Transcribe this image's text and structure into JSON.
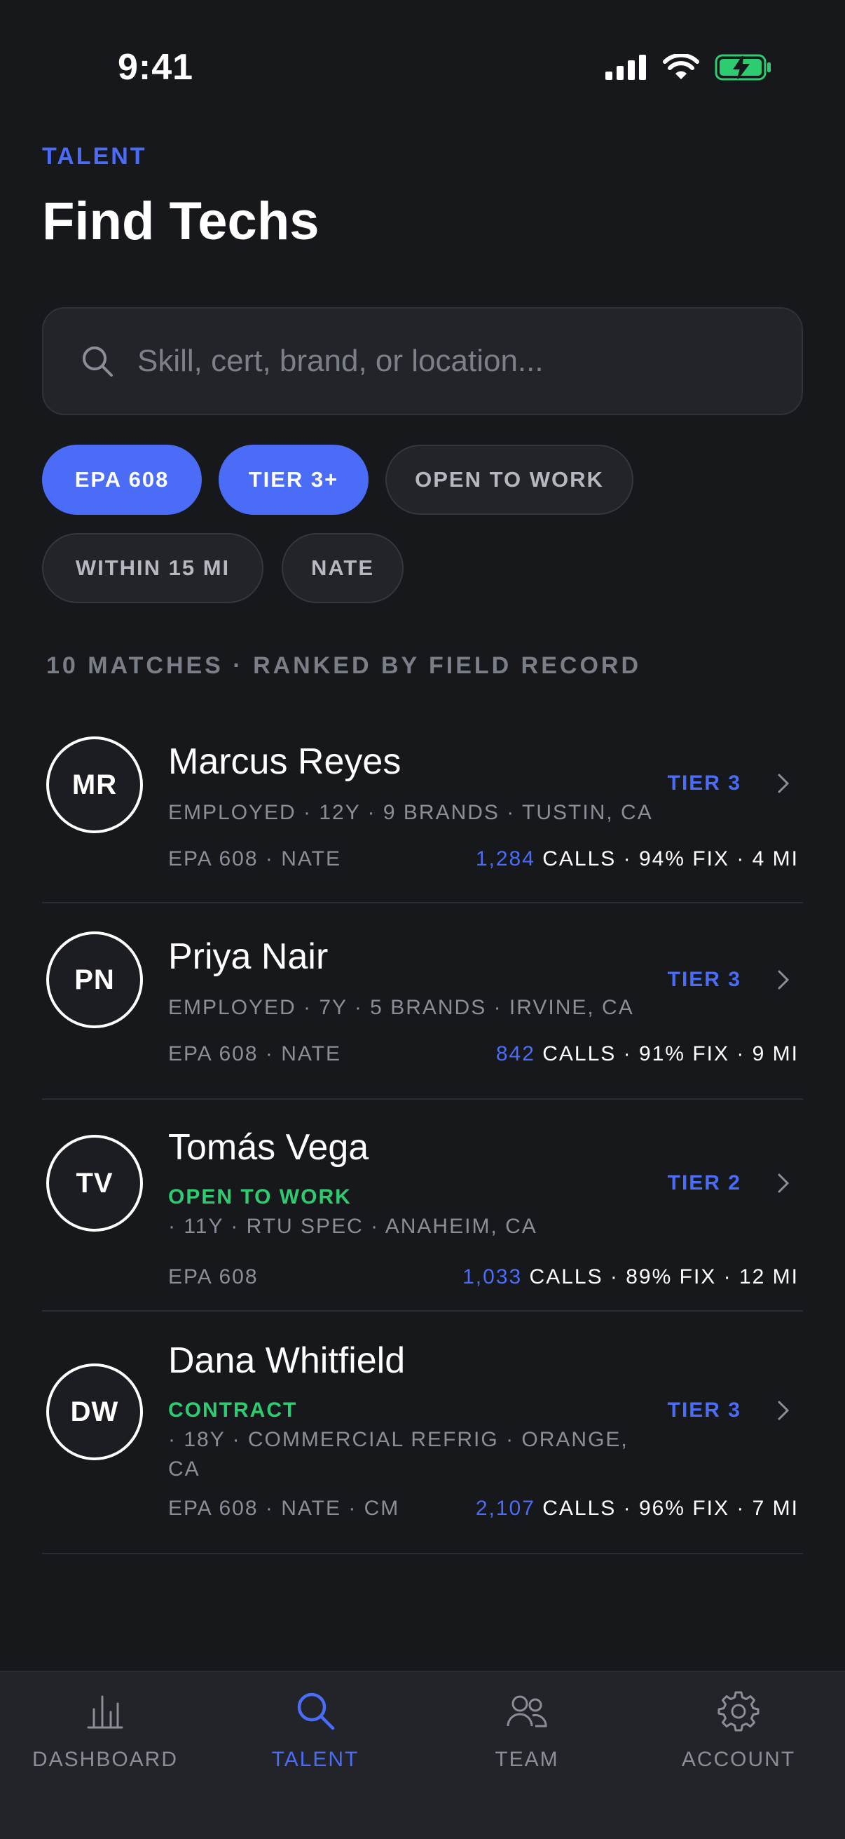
{
  "status_bar": {
    "time": "9:41"
  },
  "header": {
    "eyebrow": "TALENT",
    "title": "Find Techs"
  },
  "search": {
    "placeholder": "Skill, cert, brand, or location..."
  },
  "filters": [
    {
      "label": "EPA 608",
      "active": true
    },
    {
      "label": "TIER 3+",
      "active": true
    },
    {
      "label": "OPEN TO WORK",
      "active": false
    },
    {
      "label": "WITHIN 15 MI",
      "active": false
    },
    {
      "label": "NATE",
      "active": false
    }
  ],
  "results": {
    "summary": "10 MATCHES · RANKED BY FIELD RECORD"
  },
  "techs": [
    {
      "initials": "MR",
      "name": "Marcus Reyes",
      "status": "EMPLOYED",
      "details": "EMPLOYED · 12Y · 9 BRANDS · TUSTIN, CA",
      "certs": "EPA 608 · NATE",
      "calls": "1,284",
      "stats_rest": " CALLS · 94% FIX · 4 MI",
      "tier": "TIER 3"
    },
    {
      "initials": "PN",
      "name": "Priya Nair",
      "status": "EMPLOYED",
      "details": "EMPLOYED · 7Y · 5 BRANDS · IRVINE, CA",
      "certs": "EPA 608 · NATE",
      "calls": "842",
      "stats_rest": " CALLS · 91% FIX · 9 MI",
      "tier": "TIER 3"
    },
    {
      "initials": "TV",
      "name": "Tomás Vega",
      "status": "OPEN TO WORK",
      "details": " · 11Y · RTU SPEC · ANAHEIM, CA",
      "certs": "EPA 608",
      "calls": "1,033",
      "stats_rest": " CALLS · 89% FIX · 12 MI",
      "tier": "TIER 2"
    },
    {
      "initials": "DW",
      "name": "Dana Whitfield",
      "status": "CONTRACT",
      "details": " · 18Y · COMMERCIAL REFRIG · ORANGE, CA",
      "certs": "EPA 608 · NATE · CM",
      "calls": "2,107",
      "stats_rest": " CALLS · 96% FIX · 7 MI",
      "tier": "TIER 3"
    }
  ],
  "tabs": [
    {
      "label": "DASHBOARD",
      "icon": "bar-chart-icon"
    },
    {
      "label": "TALENT",
      "icon": "search-icon",
      "active": true
    },
    {
      "label": "TEAM",
      "icon": "people-icon"
    },
    {
      "label": "ACCOUNT",
      "icon": "gear-icon"
    }
  ],
  "colors": {
    "accent": "#4a6cf7",
    "open_status": "#2ecc71",
    "background": "#17181c"
  }
}
